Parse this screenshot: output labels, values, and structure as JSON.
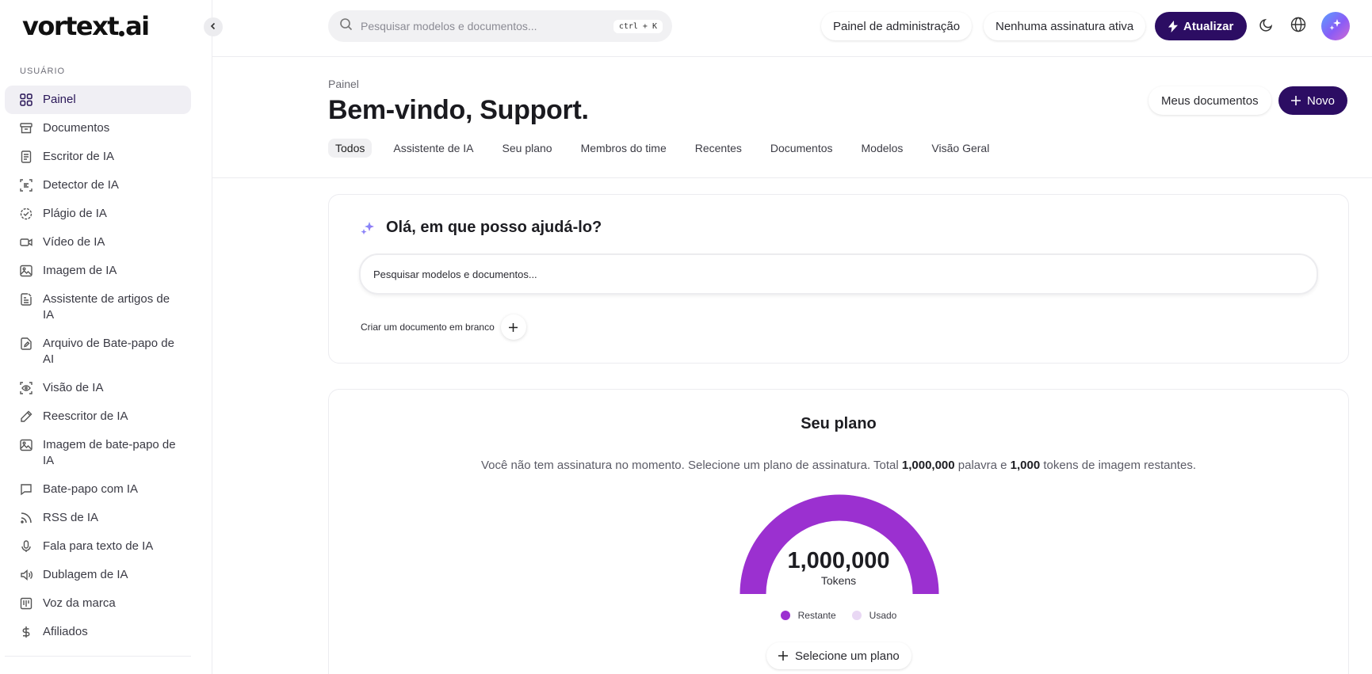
{
  "brand": {
    "logo_part1": "vortext",
    "logo_part2": "ai"
  },
  "sidebar": {
    "section_label": "USUÁRIO",
    "items": [
      {
        "label": "Painel",
        "icon": "grid-icon",
        "active": true
      },
      {
        "label": "Documentos",
        "icon": "archive-icon"
      },
      {
        "label": "Escritor de IA",
        "icon": "document-icon"
      },
      {
        "label": "Detector de IA",
        "icon": "scan-text-icon"
      },
      {
        "label": "Plágio de IA",
        "icon": "check-circle-icon"
      },
      {
        "label": "Vídeo de IA",
        "icon": "video-icon"
      },
      {
        "label": "Imagem de IA",
        "icon": "image-icon"
      },
      {
        "label": "Assistente de artigos de IA",
        "icon": "article-icon"
      },
      {
        "label": "Arquivo de Bate-papo de AI",
        "icon": "file-edit-icon"
      },
      {
        "label": "Visão de IA",
        "icon": "eye-scan-icon"
      },
      {
        "label": "Reescritor de IA",
        "icon": "pencil-icon"
      },
      {
        "label": "Imagem de bate-papo de IA",
        "icon": "image-icon"
      },
      {
        "label": "Bate-papo com IA",
        "icon": "chat-icon"
      },
      {
        "label": "RSS de IA",
        "icon": "rss-icon"
      },
      {
        "label": "Fala para texto de IA",
        "icon": "mic-icon"
      },
      {
        "label": "Dublagem de IA",
        "icon": "speaker-icon"
      },
      {
        "label": "Voz da marca",
        "icon": "columns-icon"
      },
      {
        "label": "Afiliados",
        "icon": "dollar-icon"
      }
    ]
  },
  "topbar": {
    "search_placeholder": "Pesquisar modelos e documentos...",
    "shortcut": "ctrl + K",
    "admin_label": "Painel de administração",
    "subscription_label": "Nenhuma assinatura ativa",
    "upgrade_label": "Atualizar"
  },
  "header": {
    "breadcrumb": "Painel",
    "title": "Bem-vindo, Support.",
    "my_docs_label": "Meus documentos",
    "new_label": "Novo",
    "tabs": [
      "Todos",
      "Assistente de IA",
      "Seu plano",
      "Membros do time",
      "Recentes",
      "Documentos",
      "Modelos",
      "Visão Geral"
    ]
  },
  "assistant": {
    "title": "Olá, em que posso ajudá-lo?",
    "input_placeholder": "Pesquisar modelos e documentos...",
    "blank_doc_label": "Criar um documento em branco"
  },
  "plan": {
    "title": "Seu plano",
    "desc_part1": "Você não tem assinatura no momento. Selecione um plano de assinatura. Total ",
    "words": "1,000,000",
    "desc_part2": " palavra e ",
    "image_tokens": "1,000",
    "desc_part3": " tokens de imagem restantes.",
    "gauge_value": "1,000,000",
    "gauge_unit": "Tokens",
    "remaining_fraction": 1.0,
    "legend_remaining": "Restante",
    "legend_used": "Usado",
    "select_plan_label": "Selecione um plano"
  },
  "colors": {
    "accent": "#2c0d63",
    "gauge_remaining": "#9b30d0",
    "gauge_used": "#e9d8f4"
  }
}
